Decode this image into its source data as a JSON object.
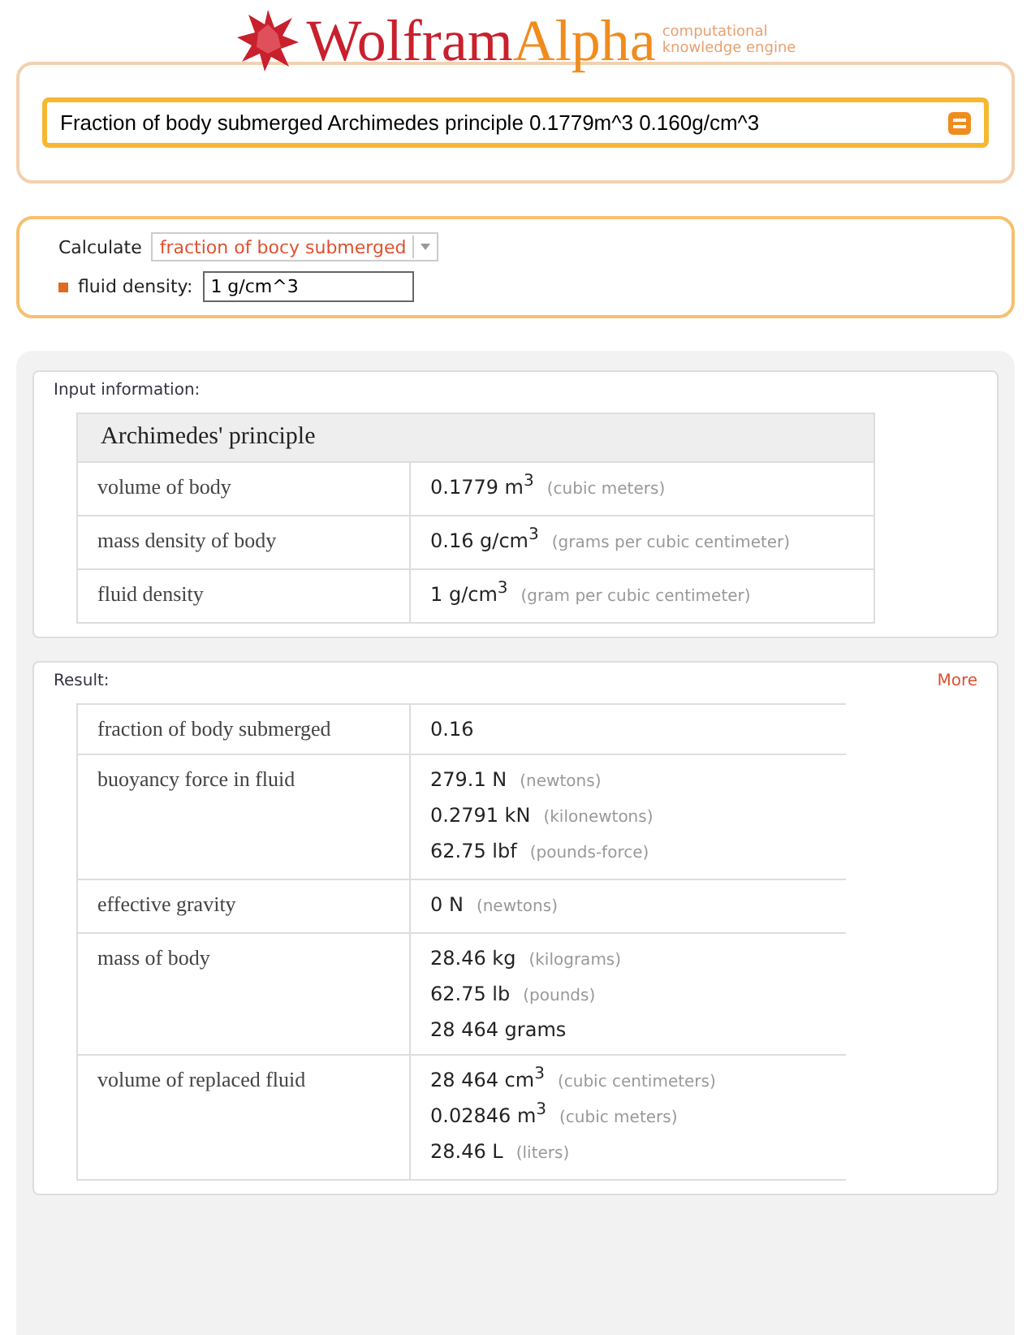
{
  "logo": {
    "word_1": "Wolfram",
    "word_2": "Alpha",
    "tagline": [
      "computational",
      "knowledge engine"
    ]
  },
  "search": {
    "value": "Fraction of body submerged Archimedes principle 0.1779m^3 0.160g/cm^3"
  },
  "assumptions": {
    "calculate_label": "Calculate",
    "calculate_value": "fraction of bocy submerged",
    "field_label": "fluid density:",
    "field_value": "1 g/cm^3"
  },
  "input_pod": {
    "title": "Input information:",
    "table_title": "Archimedes' principle",
    "rows": [
      {
        "label": "volume of body",
        "values": [
          {
            "main": "0.1779 m$^{3}$",
            "unit": "(cubic meters)"
          }
        ]
      },
      {
        "label": "mass density of body",
        "values": [
          {
            "main": "0.16 g/cm$^{3}$",
            "unit": "(grams per cubic centimeter)"
          }
        ]
      },
      {
        "label": "fluid density",
        "values": [
          {
            "main": "1 g/cm$^{3}$",
            "unit": "(gram per cubic centimeter)"
          }
        ]
      }
    ]
  },
  "result_pod": {
    "title": "Result:",
    "more": "More",
    "rows": [
      {
        "label": "fraction of body submerged",
        "values": [
          {
            "main": "0.16"
          }
        ]
      },
      {
        "label": "buoyancy force in fluid",
        "values": [
          {
            "main": "279.1 N",
            "unit": "(newtons)"
          },
          {
            "main": "0.2791 kN",
            "unit": "(kilonewtons)"
          },
          {
            "main": "62.75 lbf",
            "unit": "(pounds-force)"
          }
        ]
      },
      {
        "label": "effective gravity",
        "values": [
          {
            "main": "0 N",
            "unit": "(newtons)"
          }
        ]
      },
      {
        "label": "mass of body",
        "values": [
          {
            "main": "28.46 kg",
            "unit": "(kilograms)"
          },
          {
            "main": "62.75 lb",
            "unit": "(pounds)"
          },
          {
            "main": "28 464 grams"
          }
        ]
      },
      {
        "label": "volume of replaced fluid",
        "values": [
          {
            "main": "28 464 cm$^{3}$",
            "unit": "(cubic centimeters)"
          },
          {
            "main": "0.02846 m$^{3}$",
            "unit": "(cubic meters)"
          },
          {
            "main": "28.46 L",
            "unit": "(liters)"
          }
        ]
      }
    ]
  }
}
